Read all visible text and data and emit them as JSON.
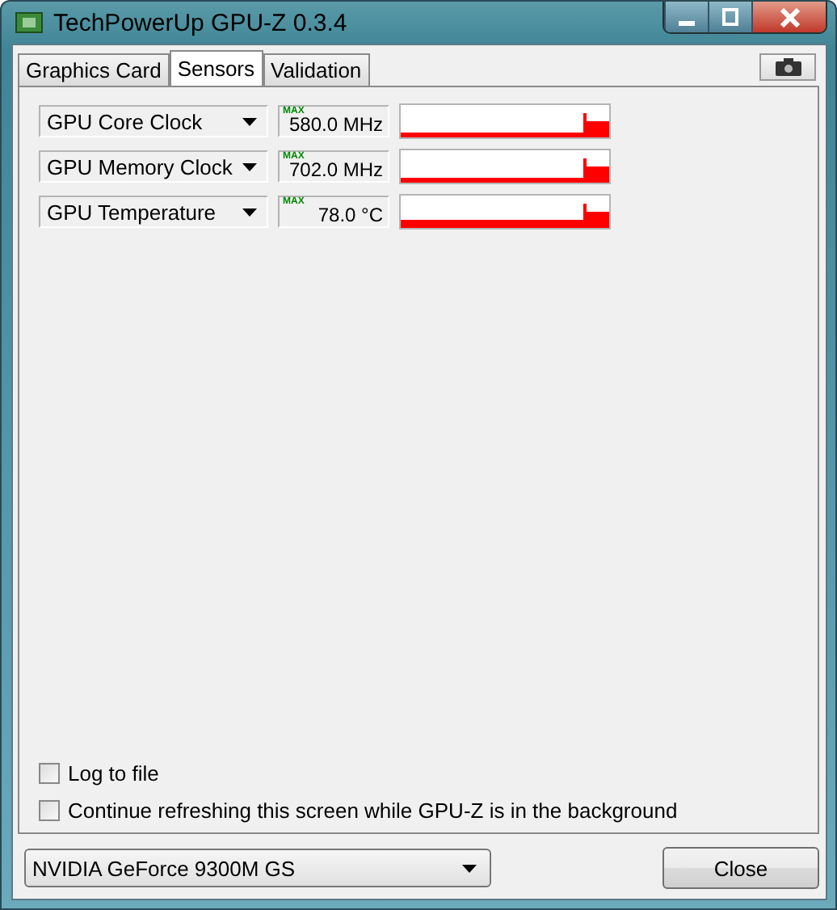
{
  "window": {
    "title": "TechPowerUp GPU-Z 0.3.4"
  },
  "tabs": [
    {
      "label": "Graphics Card",
      "selected": false
    },
    {
      "label": "Sensors",
      "selected": true
    },
    {
      "label": "Validation",
      "selected": false
    }
  ],
  "sensors": [
    {
      "name": "GPU Core Clock",
      "max_label": "MAX",
      "reading": "580.0 MHz"
    },
    {
      "name": "GPU Memory Clock",
      "max_label": "MAX",
      "reading": "702.0 MHz"
    },
    {
      "name": "GPU Temperature",
      "max_label": "MAX",
      "reading": "78.0 °C"
    }
  ],
  "options": [
    {
      "label": "Log to file",
      "checked": false
    },
    {
      "label": "Continue refreshing this screen while GPU-Z is in the background",
      "checked": false
    }
  ],
  "gpu_select": {
    "value": "NVIDIA GeForce 9300M GS"
  },
  "buttons": [
    "Close"
  ]
}
